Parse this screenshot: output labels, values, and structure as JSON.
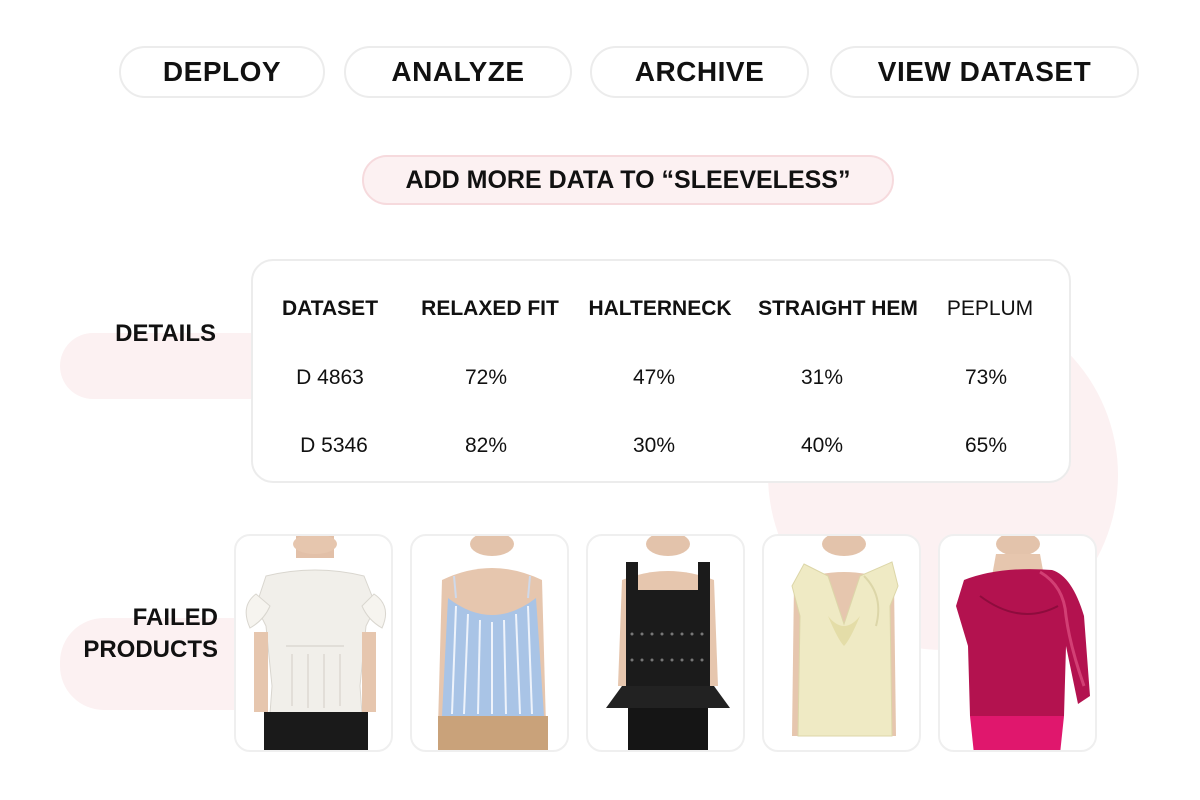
{
  "colors": {
    "accent_pink": "#fcf1f2",
    "border_gray": "#ececec",
    "text": "#111111"
  },
  "toolbar": {
    "buttons": [
      {
        "label": "DEPLOY"
      },
      {
        "label": "ANALYZE"
      },
      {
        "label": "ARCHIVE"
      },
      {
        "label": "VIEW DATASET"
      }
    ]
  },
  "cta": {
    "label": "ADD MORE DATA TO “SLEEVELESS”"
  },
  "details": {
    "section_label": "DETAILS",
    "headers": [
      "DATASET",
      "RELAXED FIT",
      "HALTERNECK",
      "STRAIGHT HEM",
      "PEPLUM"
    ],
    "rows": [
      [
        "D 4863",
        "72%",
        "47%",
        "31%",
        "73%"
      ],
      [
        "D 5346",
        "82%",
        "30%",
        "40%",
        "65%"
      ]
    ]
  },
  "failed_products": {
    "label_line1": "FAILED",
    "label_line2": "PRODUCTS",
    "items": [
      {
        "icon": "white-ruffle-top-image",
        "color": "#f1efea"
      },
      {
        "icon": "striped-blue-camisole-image",
        "color": "#a9c4e6"
      },
      {
        "icon": "black-peplum-top-image",
        "color": "#1b1b1b"
      },
      {
        "icon": "yellow-twist-halter-image",
        "color": "#efeac4"
      },
      {
        "icon": "magenta-draped-top-image",
        "color": "#b3124f"
      }
    ]
  }
}
